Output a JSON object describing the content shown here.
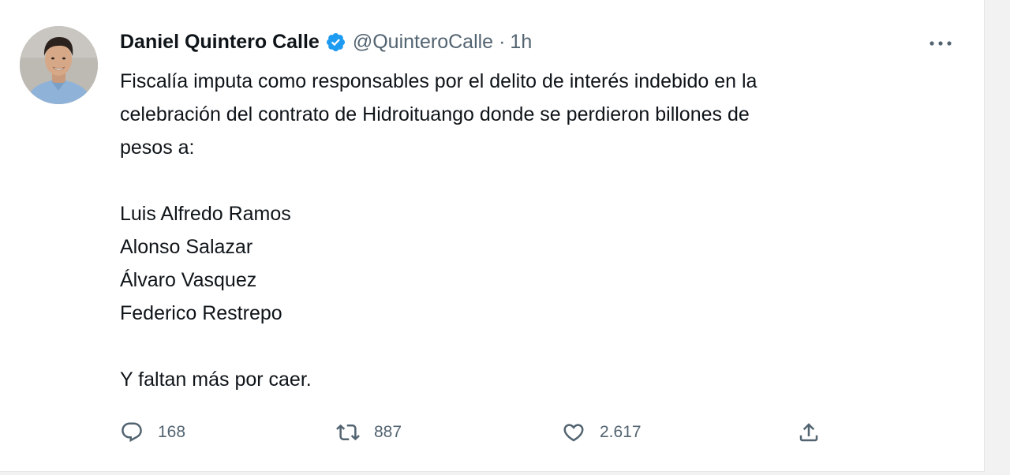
{
  "tweet": {
    "author": {
      "display_name": "Daniel Quintero Calle",
      "handle": "@QuinteroCalle",
      "verified": true,
      "separator": "·",
      "time": "1h"
    },
    "more_icon": "more-horizontal-icon",
    "lines": {
      "p1": "Fiscalía imputa como responsables por el delito de interés indebido en la",
      "p2": "celebración del contrato de Hidroituango donde se perdieron billones de",
      "p3": "pesos a:",
      "n1": "Luis Alfredo Ramos",
      "n2": "Alonso Salazar",
      "n3": "Álvaro Vasquez",
      "n4": "Federico Restrepo",
      "closing": "Y faltan más por caer."
    },
    "actions": {
      "reply": {
        "icon": "reply-icon",
        "count": "168"
      },
      "retweet": {
        "icon": "retweet-icon",
        "count": "887"
      },
      "like": {
        "icon": "heart-icon",
        "count": "2.617"
      },
      "share": {
        "icon": "share-icon"
      }
    }
  },
  "colors": {
    "text_primary": "#0f1419",
    "text_secondary": "#536471",
    "verified_blue": "#1d9bf0",
    "background": "#ffffff"
  }
}
